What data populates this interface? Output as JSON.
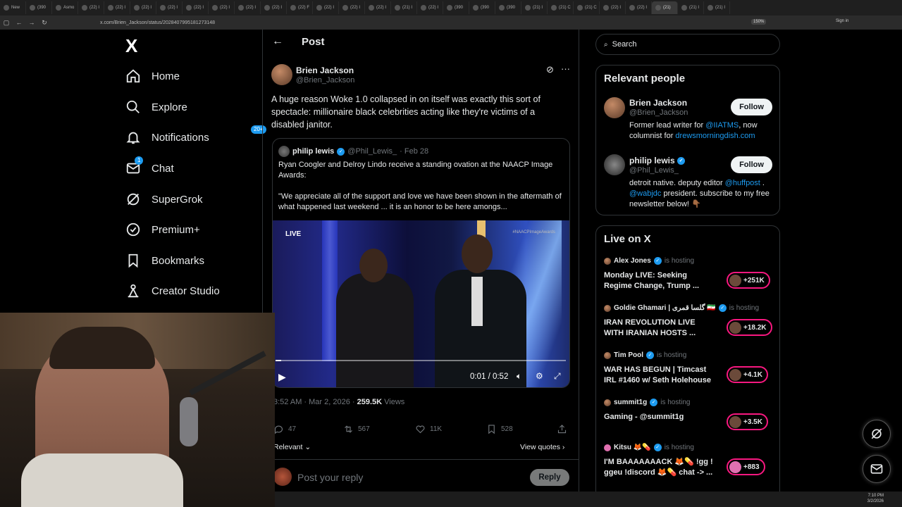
{
  "browser": {
    "tabs": [
      "New",
      "(390",
      "Asmo",
      "(22) I",
      "(22) I",
      "(22) I",
      "(22) I",
      "(22) I",
      "(22) I",
      "(22) I",
      "(22) I",
      "(22) F",
      "(22) I",
      "(22) I",
      "(22) I",
      "(21) I",
      "(22) I",
      "(390",
      "(390",
      "(390",
      "(21) I",
      "(21) C",
      "(21) C",
      "(22) I",
      "(22) I",
      "(21)",
      "(21) I",
      "(21) I"
    ],
    "url": "x.com/Brien_Jackson/status/2028407995181273148",
    "zoom": "150%",
    "signin": "Sign in"
  },
  "sidebar": {
    "logo": "X",
    "items": [
      {
        "label": "Home",
        "icon": "home-icon"
      },
      {
        "label": "Explore",
        "icon": "search-icon"
      },
      {
        "label": "Notifications",
        "icon": "bell-icon",
        "badge": "20+"
      },
      {
        "label": "Chat",
        "icon": "mail-icon",
        "badge": "1"
      },
      {
        "label": "SuperGrok",
        "icon": "grok-icon"
      },
      {
        "label": "Premium+",
        "icon": "premium-icon"
      },
      {
        "label": "Bookmarks",
        "icon": "bookmark-icon"
      },
      {
        "label": "Creator Studio",
        "icon": "creator-icon"
      }
    ]
  },
  "post": {
    "header_title": "Post",
    "author_name": "Brien Jackson",
    "author_handle": "@Brien_Jackson",
    "text": "A huge reason Woke 1.0 collapsed in on itself was exactly this sort of spectacle: millionaire black celebrities acting like they're victims of a disabled janitor.",
    "quote": {
      "name": "philip lewis",
      "handle": "@Phil_Lewis_",
      "date": "· Feb 28",
      "text1": "Ryan Coogler and Delroy Lindo receive a standing ovation at the NAACP Image Awards:",
      "text2": "\"We appreciate all of the support and love we have been shown in the aftermath of what happened last weekend ... it is an honor to be here amongs...",
      "video": {
        "live_tag": "LIVE",
        "hashtag": "#NAACPImageAwards",
        "timecode": "0:01 / 0:52",
        "progress": 0.02
      }
    },
    "meta_time": "3:52 AM · Mar 2, 2026 · ",
    "views_count": "259.5K",
    "views_label": " Views",
    "actions": {
      "replies": "47",
      "reposts": "567",
      "likes": "11K",
      "bookmarks": "528"
    },
    "relevant_label": "Relevant ⌄",
    "view_quotes": "View quotes ›",
    "reply_placeholder": "Post your reply",
    "reply_button": "Reply"
  },
  "right": {
    "search_placeholder": "Search",
    "relevant_title": "Relevant people",
    "people": [
      {
        "name": "Brien Jackson",
        "handle": "@Brien_Jackson",
        "follow": "Follow",
        "bio_text1": "Former lead writer for ",
        "bio_link1": "@IIATMS",
        "bio_text2": ", now columnist for ",
        "bio_link2": "drewsmorningdish.com"
      },
      {
        "name": "philip lewis",
        "handle": "@Phil_Lewis_",
        "follow": "Follow",
        "bio_text1": "detroit native. deputy editor ",
        "bio_link1": "@huffpost",
        "bio_text2": " . ",
        "bio_link2": "@wabjdc",
        "bio_text3": " president. subscribe to my free newsletter below! 👇🏾"
      }
    ],
    "live_title": "Live on X",
    "live": [
      {
        "host": "Alex Jones",
        "hosting": "is hosting",
        "title": "Monday LIVE: Seeking Regime Change, Trump ...",
        "count": "+251K"
      },
      {
        "host": "Goldie Ghamari | گلسا قمری 🇮🇷",
        "hosting": "is hosting",
        "title": "IRAN REVOLUTION LIVE WITH IRANIAN HOSTS ...",
        "count": "+18.2K"
      },
      {
        "host": "Tim Pool",
        "hosting": "is hosting",
        "title": "WAR HAS BEGUN | Timcast IRL #1460 w/ Seth Holehouse",
        "count": "+4.1K"
      },
      {
        "host": "summit1g",
        "hosting": "is hosting",
        "title": "Gaming - @summit1g",
        "count": "+3.5K"
      },
      {
        "host": "Kitsu 🦊💊",
        "hosting": "is hosting",
        "title": "I'M BAAAAAAACK 🦊💊 !gg ! ggeu !discord 🦊💊 chat -> ...",
        "count": "+883"
      }
    ]
  },
  "taskbar": {
    "time": "7:10 PM",
    "date": "3/2/2026"
  },
  "colors": {
    "accent": "#1d9bf0",
    "live_ring": "#f91880",
    "background": "#000000",
    "border": "#2f3336"
  }
}
